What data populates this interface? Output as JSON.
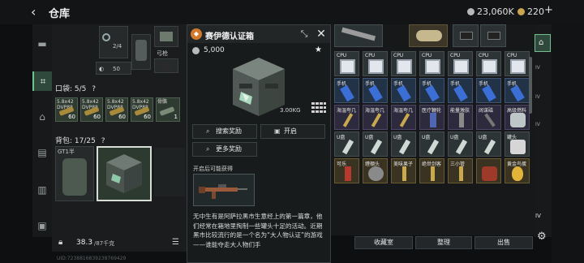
{
  "header": {
    "title": "仓库",
    "currency_a": "23,060K",
    "currency_b": "220",
    "add_label": "+"
  },
  "gear": {
    "slot_count": "2/4",
    "slot_label": "弓枪",
    "count_50": "50",
    "pocket_label": "口袋: 5/5",
    "pocket_help": "?",
    "ammo": [
      {
        "name": "5.8x42 DVP88",
        "count": "60"
      },
      {
        "name": "5.8x42 DVP88",
        "count": "60"
      },
      {
        "name": "5.8x42 DVP88",
        "count": "60"
      },
      {
        "name": "5.8x42 DVP88",
        "count": "60"
      },
      {
        "name": "骨骼",
        "count": "1"
      }
    ],
    "backpack_label": "背包: 17/25",
    "backpack_help": "?",
    "backpack_item": "GT1半",
    "weight": "38.3",
    "weight_max": "/87千克"
  },
  "detail": {
    "title": "赛伊德认证箱",
    "price": "5,000",
    "weight": "3.00KG",
    "actions": {
      "search": "搜索奖励",
      "open": "开启",
      "more": "更多奖励"
    },
    "unlock_label": "开启后可能获得",
    "description": "无中生有是阿萨拉黑市生意经上的第一篇章，他们经常在箱地里掏制一些罐头十足的活动。近期黑市比较流行的是一个名为“大人物认证”的游戏——谁能夺走大人物们手"
  },
  "inventory": {
    "rows": [
      [
        "CPU",
        "CPU",
        "CPU",
        "CPU",
        "CPU",
        "CPU",
        "CPU"
      ],
      [
        "手机",
        "手机",
        "手机",
        "手机",
        "手机",
        "手机",
        "手机"
      ],
      [
        "海温夸几",
        "海温夸几",
        "海温夸几",
        "医疗鞭轮",
        "能量激肤",
        "阔谋磁",
        "高级燃料"
      ],
      [
        "U盘",
        "U盘",
        "U盘",
        "U盘",
        "U盘",
        "U盘",
        "罐头"
      ],
      [
        "可乐",
        "缠棚头",
        "美味果子",
        "绝世剑客",
        "三小管",
        "",
        "黄金鸟蛋"
      ]
    ],
    "row_colors": [
      "#dfe6ef",
      "#3b6fd6",
      "#6e5db8",
      "#cdd9d2",
      "#c7a34a"
    ]
  },
  "bottom": {
    "favorites": "收藏室",
    "sort": "整理",
    "sell": "出售"
  },
  "footer_id": "UID:7238816839238769429"
}
